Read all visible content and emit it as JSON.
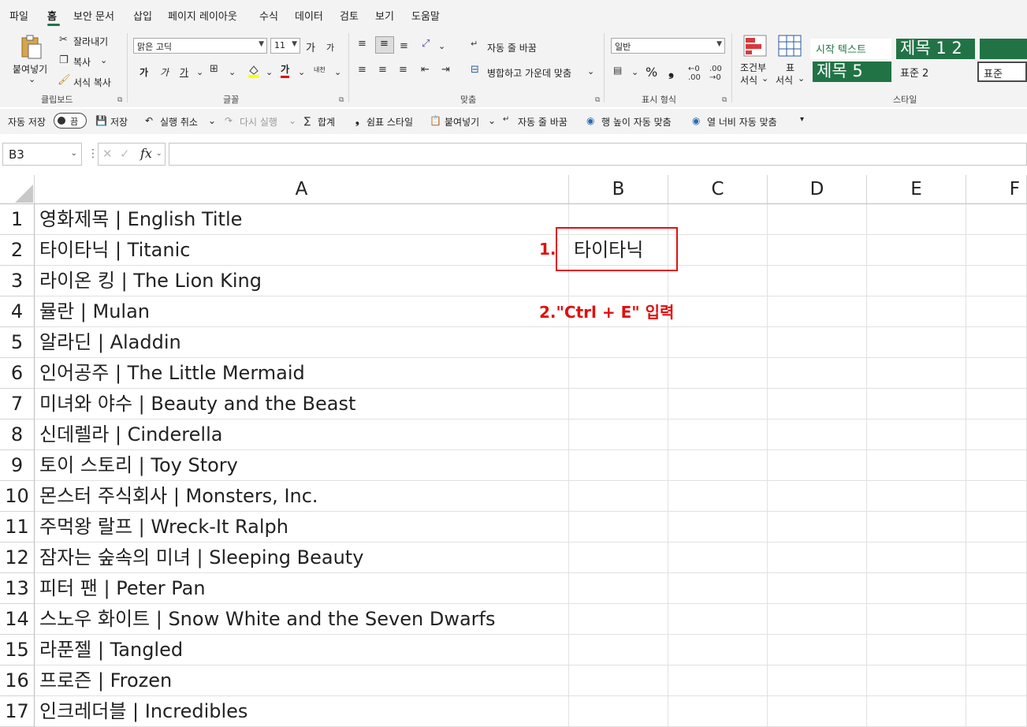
{
  "menu": {
    "items": [
      "파일",
      "홈",
      "보안 문서",
      "삽입",
      "페이지 레이아웃",
      "수식",
      "데이터",
      "검토",
      "보기",
      "도움말"
    ],
    "active": "홈"
  },
  "ribbon": {
    "clipboard": {
      "paste": "붙여넣기",
      "cut": "잘라내기",
      "copy": "복사",
      "format_painter": "서식 복사",
      "label": "클립보드"
    },
    "font": {
      "name": "맑은 고딕",
      "size": "11",
      "grow": "가",
      "shrink": "가",
      "bold": "가",
      "italic": "가",
      "underline": "가",
      "font_color": "가",
      "phonetic": "내천",
      "label": "글꼴"
    },
    "alignment": {
      "wrap": "자동 줄 바꿈",
      "merge": "병합하고 가운데 맞춤",
      "label": "맞춤"
    },
    "number": {
      "format": "일반",
      "percent": "%",
      "comma": "❟",
      "label": "표시 형식"
    },
    "styles": {
      "conditional": "조건부",
      "conditional2": "서식",
      "table": "표",
      "table2": "서식",
      "start_text": "시작 텍스트",
      "heading12": "제목 1 2",
      "heading5": "제목 5",
      "normal2": "표준 2",
      "normal": "표준",
      "label": "스타일",
      "green": "#217346"
    }
  },
  "qat": {
    "autosave": "자동 저장",
    "toggle": "끔",
    "save": "저장",
    "undo": "실행 취소",
    "redo": "다시 실행",
    "sum": "합계",
    "comma_style": "쉼표 스타일",
    "paste": "붙여넣기",
    "wrap": "자동 줄 바꿈",
    "row_autofit": "행 높이 자동 맞춤",
    "col_autofit": "열 너비 자동 맞춤"
  },
  "formula_bar": {
    "name_box": "B3",
    "fx": "fx",
    "value": ""
  },
  "sheet": {
    "columns": [
      "A",
      "B",
      "C",
      "D",
      "E",
      "F"
    ],
    "rows": [
      {
        "num": "1",
        "a": "영화제목 | English Title",
        "b": ""
      },
      {
        "num": "2",
        "a": "타이타닉 | Titanic",
        "b": "타이타닉"
      },
      {
        "num": "3",
        "a": "라이온 킹 | The Lion King",
        "b": ""
      },
      {
        "num": "4",
        "a": "뮬란 | Mulan",
        "b": ""
      },
      {
        "num": "5",
        "a": "알라딘 | Aladdin",
        "b": ""
      },
      {
        "num": "6",
        "a": "인어공주 | The Little Mermaid",
        "b": ""
      },
      {
        "num": "7",
        "a": "미녀와 야수 | Beauty and the Beast",
        "b": ""
      },
      {
        "num": "8",
        "a": "신데렐라 | Cinderella",
        "b": ""
      },
      {
        "num": "9",
        "a": "토이 스토리 | Toy Story",
        "b": ""
      },
      {
        "num": "10",
        "a": "몬스터 주식회사 | Monsters, Inc.",
        "b": ""
      },
      {
        "num": "11",
        "a": "주먹왕 랄프 | Wreck-It Ralph",
        "b": ""
      },
      {
        "num": "12",
        "a": "잠자는 숲속의 미녀 | Sleeping Beauty",
        "b": ""
      },
      {
        "num": "13",
        "a": "피터 팬 | Peter Pan",
        "b": ""
      },
      {
        "num": "14",
        "a": "스노우 화이트 | Snow White and the Seven Dwarfs",
        "b": ""
      },
      {
        "num": "15",
        "a": "라푼젤 | Tangled",
        "b": ""
      },
      {
        "num": "16",
        "a": "프로즌 | Frozen",
        "b": ""
      },
      {
        "num": "17",
        "a": "인크레더블 | Incredibles",
        "b": ""
      }
    ]
  },
  "annotations": {
    "step1": "1.",
    "step2": "2.\"Ctrl + E\" 입력",
    "color": "#e01010"
  }
}
